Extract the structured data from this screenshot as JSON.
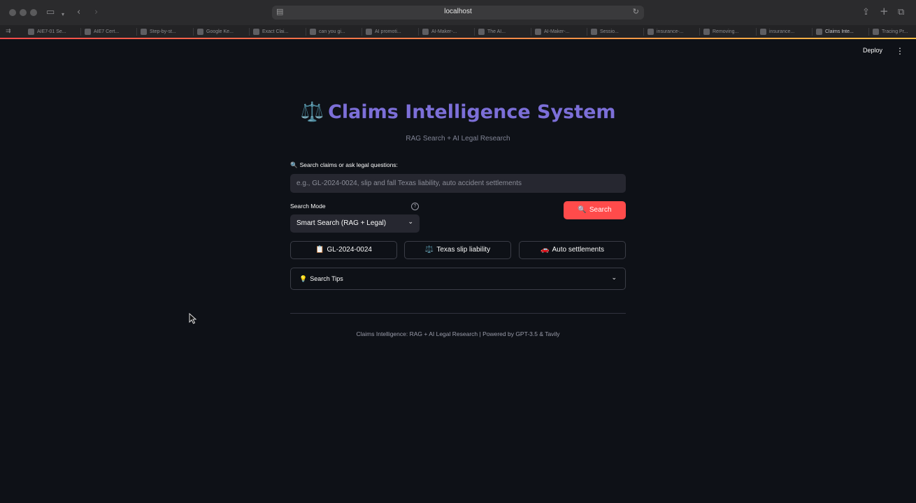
{
  "browser": {
    "url": "localhost",
    "tabs": [
      {
        "label": "AIE7-01 Se..."
      },
      {
        "label": "AIE7 Cert..."
      },
      {
        "label": "Step-by-st..."
      },
      {
        "label": "Google Ke..."
      },
      {
        "label": "Exact Clai..."
      },
      {
        "label": "can you gi..."
      },
      {
        "label": "AI promoti..."
      },
      {
        "label": "AI-Maker-..."
      },
      {
        "label": "The AI..."
      },
      {
        "label": "AI-Maker-..."
      },
      {
        "label": "Sessio..."
      },
      {
        "label": "insurance-..."
      },
      {
        "label": "Removing..."
      },
      {
        "label": "insurance..."
      },
      {
        "label": "Claims Inte..."
      },
      {
        "label": "Tracing Pr..."
      }
    ],
    "active_tab_index": 14
  },
  "app": {
    "deploy_label": "Deploy",
    "title": "Claims Intelligence System",
    "title_emoji": "⚖️",
    "subtitle": "RAG Search + AI Legal Research",
    "search_label": "Search claims or ask legal questions:",
    "search_placeholder": "e.g., GL-2024-0024, slip and fall Texas liability, auto accident settlements",
    "search_value": "",
    "search_mode_label": "Search Mode",
    "search_mode_value": "Smart Search (RAG + Legal)",
    "search_button_label": "Search",
    "quick_buttons": [
      {
        "label": "GL-2024-0024",
        "emoji": "📋"
      },
      {
        "label": "Texas slip liability",
        "emoji": "⚖️"
      },
      {
        "label": "Auto settlements",
        "emoji": "🚗"
      }
    ],
    "tips_label": "Search Tips",
    "footer": "Claims Intelligence: RAG + AI Legal Research | Powered by GPT-3.5 & Tavily"
  },
  "colors": {
    "background": "#0e1117",
    "title": "#7c6fd8",
    "primary_button": "#ff4b4b",
    "input_bg": "#262730"
  }
}
